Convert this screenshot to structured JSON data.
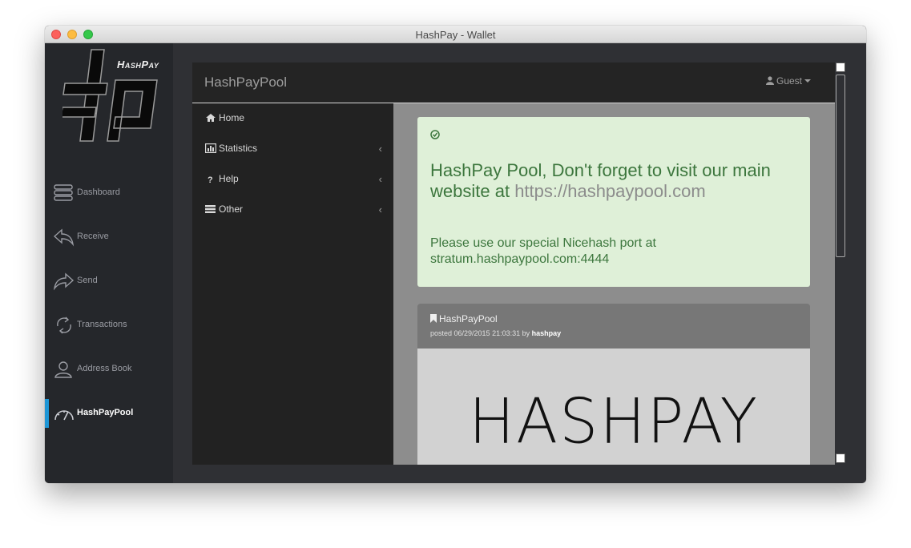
{
  "window": {
    "title": "HashPay - Wallet"
  },
  "app": {
    "logo_text": "HashPay",
    "nav": [
      {
        "label": "Dashboard",
        "icon": "dashboard-icon"
      },
      {
        "label": "Receive",
        "icon": "receive-icon"
      },
      {
        "label": "Send",
        "icon": "send-icon"
      },
      {
        "label": "Transactions",
        "icon": "transactions-icon"
      },
      {
        "label": "Address Book",
        "icon": "address-book-icon"
      },
      {
        "label": "HashPayPool",
        "icon": "gauge-icon",
        "active": true
      }
    ],
    "status_icons": [
      "lock-icon",
      "lightning-icon",
      "signal-icon",
      "check-icon"
    ]
  },
  "site": {
    "brand": "HashPayPool",
    "user": "Guest",
    "menu": [
      {
        "label": "Home",
        "icon": "home-icon",
        "expandable": false
      },
      {
        "label": "Statistics",
        "icon": "bar-chart-icon",
        "expandable": true
      },
      {
        "label": "Help",
        "icon": "question-icon",
        "expandable": true
      },
      {
        "label": "Other",
        "icon": "list-icon",
        "expandable": true
      }
    ],
    "chevron": "‹",
    "alert": {
      "headline": "HashPay Pool, Don't forget to visit our main website at",
      "link": "https://hashpaypool.com",
      "notice": "Please use our special Nicehash port at stratum.hashpaypool.com:4444"
    },
    "post": {
      "title": "HashPayPool",
      "posted_prefix": "posted 06/29/2015 21:03:31 by",
      "author": "hashpay",
      "banner": "HASHPAY"
    }
  },
  "colors": {
    "accent": "#1d96d6",
    "alert_bg": "#dff0d8",
    "alert_text": "#3c763d"
  }
}
